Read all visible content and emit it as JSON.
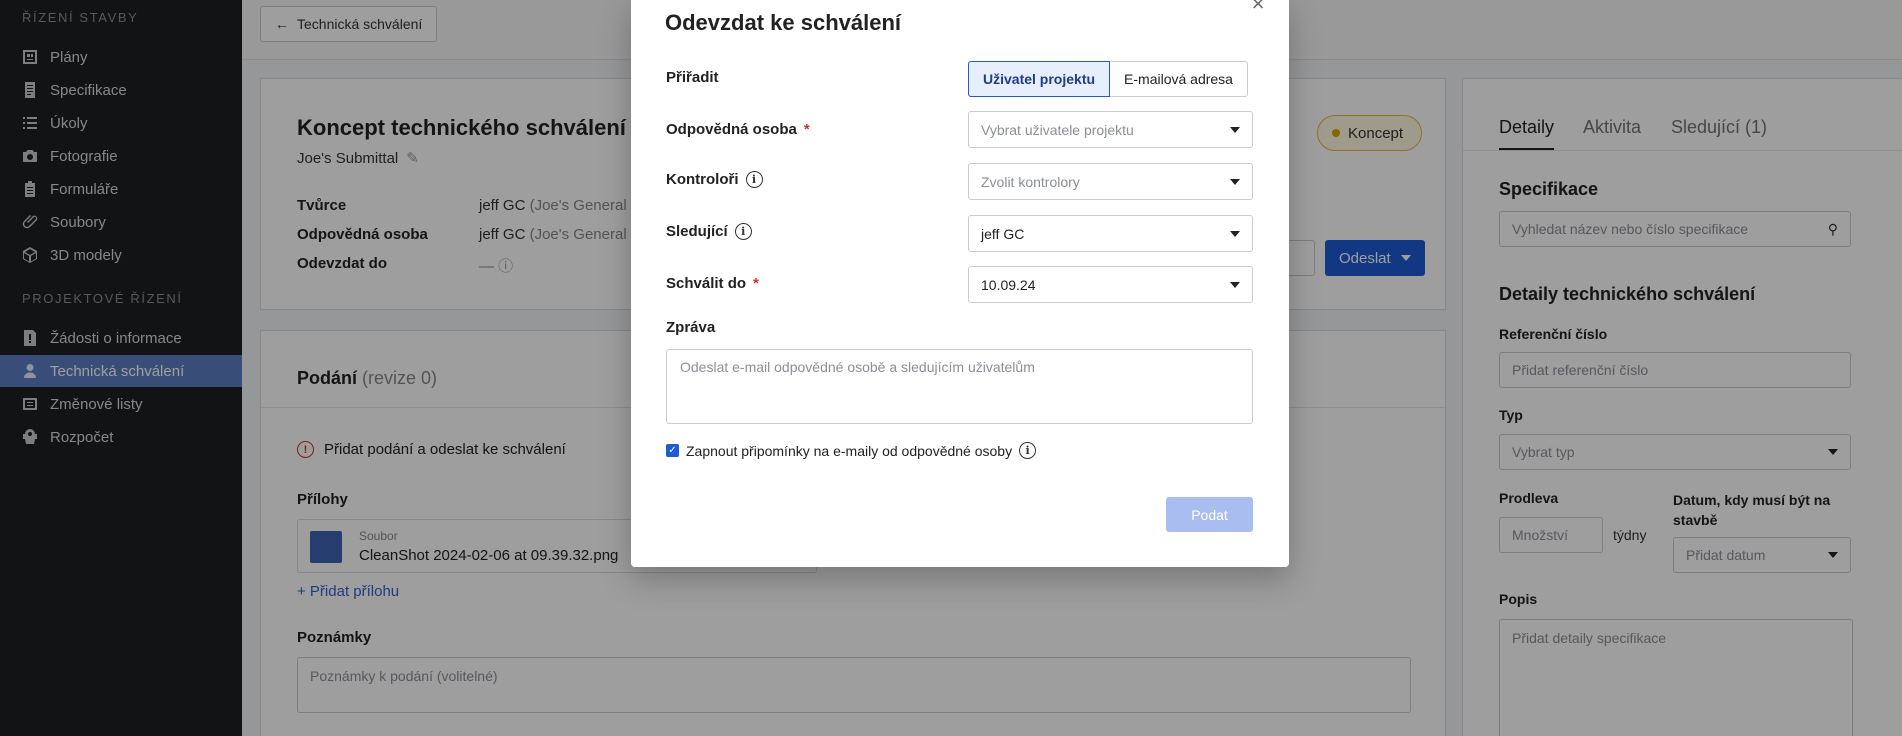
{
  "sidebar": {
    "section1": "Řízení stavby",
    "items1": [
      {
        "label": "Plány",
        "icon": "plans-icon"
      },
      {
        "label": "Specifikace",
        "icon": "specifications-icon"
      },
      {
        "label": "Úkoly",
        "icon": "tasks-icon"
      },
      {
        "label": "Fotografie",
        "icon": "camera-icon"
      },
      {
        "label": "Formuláře",
        "icon": "forms-icon"
      },
      {
        "label": "Soubory",
        "icon": "paperclip-icon"
      },
      {
        "label": "3D modely",
        "icon": "cube-icon"
      }
    ],
    "section2": "Projektové řízení",
    "items2": [
      {
        "label": "Žádosti o informace",
        "icon": "rfi-icon"
      },
      {
        "label": "Technická schválení",
        "icon": "submittal-icon"
      },
      {
        "label": "Změnové listy",
        "icon": "change-order-icon"
      },
      {
        "label": "Rozpočet",
        "icon": "budget-icon"
      }
    ],
    "active_index": 1
  },
  "topbar": {
    "back_label": "Technická schválení"
  },
  "submittal": {
    "title": "Koncept technického schválení",
    "subtitle": "Joe's Submittal",
    "status": "Koncept",
    "meta": [
      {
        "label": "Tvůrce",
        "value": "jeff GC",
        "muted": "(Joe's General Contr"
      },
      {
        "label": "Odpovědná osoba",
        "value": "jeff GC",
        "muted": "(Joe's General Contr"
      },
      {
        "label": "Odevzdat do",
        "value": "—"
      }
    ],
    "send_label": "Odeslat"
  },
  "submission": {
    "title": "Podání",
    "revision": "(revize 0)",
    "warning": "Přidat podání a odeslat ke schválení",
    "attachments_label": "Přílohy",
    "file_caption": "Soubor",
    "file_name": "CleanShot 2024-02-06 at 09.39.32.png",
    "add_attachment": "+ Přidat přílohu",
    "notes_label": "Poznámky",
    "notes_placeholder": "Poznámky k podání (volitelné)"
  },
  "right_panel": {
    "tabs": [
      "Detaily",
      "Aktivita",
      "Sledující (1)"
    ],
    "spec_title": "Specifikace",
    "spec_search_placeholder": "Vyhledat název nebo číslo specifikace",
    "details_title": "Detaily technického schválení",
    "ref_label": "Referenční číslo",
    "ref_placeholder": "Přidat referenční číslo",
    "type_label": "Typ",
    "type_placeholder": "Vybrat typ",
    "lead_label": "Prodleva",
    "lead_placeholder": "Množství",
    "lead_unit": "týdny",
    "required_label": "Datum, kdy musí být na stavbě",
    "required_placeholder": "Přidat datum",
    "desc_label": "Popis",
    "desc_placeholder": "Přidat detaily specifikace"
  },
  "modal": {
    "title": "Odevzdat ke schválení",
    "assign_label": "Přiřadit",
    "assign_options": [
      "Uživatel projektu",
      "E-mailová adresa"
    ],
    "responsible_label": "Odpovědná osoba",
    "responsible_placeholder": "Vybrat uživatele projektu",
    "reviewers_label": "Kontroloři",
    "reviewers_placeholder": "Zvolit kontrolory",
    "watchers_label": "Sledující",
    "watchers_value": "jeff GC",
    "approve_by_label": "Schválit do",
    "approve_by_value": "10.09.24",
    "message_label": "Zpráva",
    "message_placeholder": "Odeslat e-mail odpovědné osobě a sledujícím uživatelům",
    "reminder_label": "Zapnout připomínky na e-maily od odpovědné osoby",
    "reminder_checked": true,
    "submit_label": "Podat"
  }
}
